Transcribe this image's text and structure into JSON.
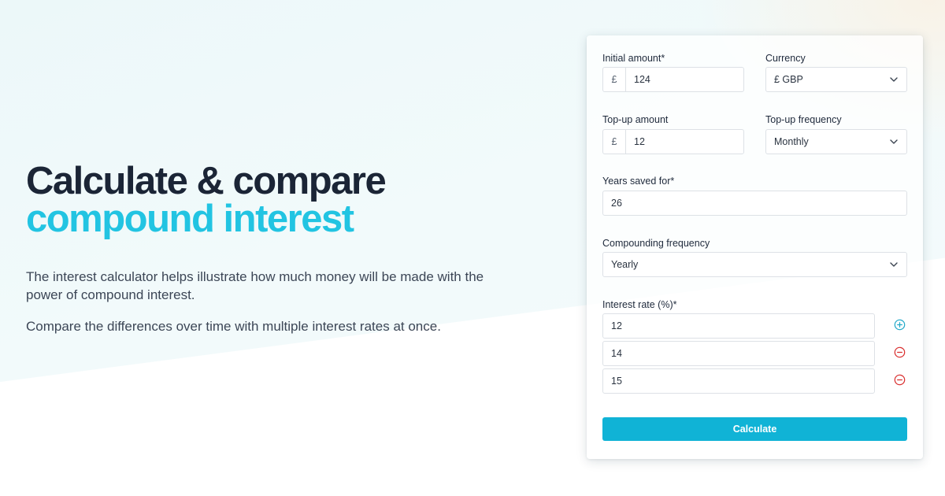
{
  "hero": {
    "title_line1": "Calculate & compare",
    "title_line2": "compound interest",
    "paragraph1": "The interest calculator helps illustrate how much money will be made with the power of compound interest.",
    "paragraph2": "Compare the differences over time with multiple interest rates at once."
  },
  "form": {
    "initial_amount": {
      "label": "Initial amount*",
      "prefix": "£",
      "value": "124"
    },
    "currency": {
      "label": "Currency",
      "value": "£ GBP"
    },
    "topup_amount": {
      "label": "Top-up amount",
      "prefix": "£",
      "value": "12"
    },
    "topup_frequency": {
      "label": "Top-up frequency",
      "value": "Monthly"
    },
    "years": {
      "label": "Years saved for*",
      "value": "26"
    },
    "compounding": {
      "label": "Compounding frequency",
      "value": "Yearly"
    },
    "interest": {
      "label": "Interest rate (%)*",
      "rates": [
        "12",
        "14",
        "15"
      ]
    },
    "calculate_label": "Calculate"
  },
  "icons": {
    "add_rate": "plus-circle-icon",
    "remove_rate": "minus-circle-icon",
    "select": "chevron-down-icon"
  },
  "colors": {
    "accent": "#22c4e2",
    "button": "#10b3d6",
    "add_icon": "#21a9c9",
    "remove_icon": "#d92d2d",
    "heading": "#1b2536"
  }
}
